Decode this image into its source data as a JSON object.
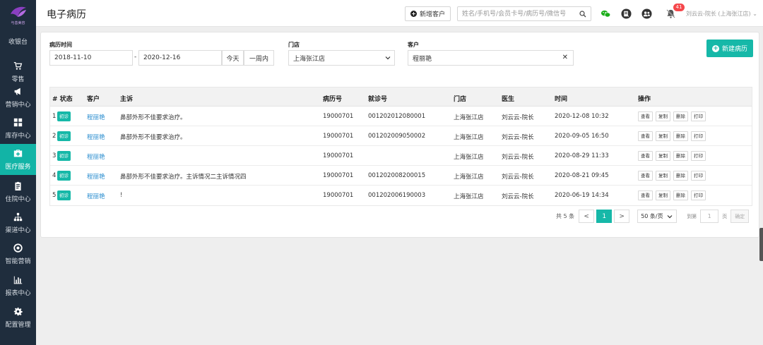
{
  "app": {
    "logo_text": "与善美容"
  },
  "sidebar": {
    "items": [
      {
        "label": "收银台",
        "icon": "cashier-icon"
      },
      {
        "label": "零售",
        "icon": "cart-icon"
      },
      {
        "label": "营销中心",
        "icon": "megaphone-icon"
      },
      {
        "label": "库存中心",
        "icon": "grid-icon"
      },
      {
        "label": "医疗服务",
        "icon": "medkit-icon",
        "active": true
      },
      {
        "label": "住院中心",
        "icon": "clipboard-icon"
      },
      {
        "label": "渠道中心",
        "icon": "sitemap-icon"
      },
      {
        "label": "智能营销",
        "icon": "life-ring-icon"
      },
      {
        "label": "报表中心",
        "icon": "bar-chart-icon"
      },
      {
        "label": "配置管理",
        "icon": "gear-icon"
      }
    ]
  },
  "header": {
    "title": "电子病历",
    "add_customer_label": "新增客户",
    "search_placeholder": "姓名/手机号/会员卡号/病历号/微信号",
    "notification_count": "41",
    "user": "刘云云-院长 (上海张江店)"
  },
  "filters": {
    "date_label": "病历时间",
    "date_from": "2018-11-10",
    "date_sep": "-",
    "date_to": "2020-12-16",
    "today_label": "今天",
    "week_label": "一周内",
    "store_label": "门店",
    "store_value": "上海张江店",
    "customer_label": "客户",
    "customer_value": "程丽艳",
    "clear_symbol": "✕",
    "new_record_label": "新建病历"
  },
  "table": {
    "headers": {
      "index_status": "# 状态",
      "customer": "客户",
      "complaint": "主诉",
      "record_no": "病历号",
      "visit_no": "就诊号",
      "store": "门店",
      "doctor": "医生",
      "time": "时间",
      "actions": "操作"
    },
    "action_labels": {
      "view": "查看",
      "copy": "复制",
      "delete": "删除",
      "print": "打印"
    },
    "rows": [
      {
        "index": "1",
        "status": "初诊",
        "customer": "程丽艳",
        "complaint": "鼻部外形不佳要求治疗。",
        "record_no": "19000701",
        "visit_no": "001202012080001",
        "store": "上海张江店",
        "doctor": "刘云云-院长",
        "time": "2020-12-08 10:32"
      },
      {
        "index": "2",
        "status": "初诊",
        "customer": "程丽艳",
        "complaint": "鼻部外形不佳要求治疗。",
        "record_no": "19000701",
        "visit_no": "001202009050002",
        "store": "上海张江店",
        "doctor": "刘云云-院长",
        "time": "2020-09-05 16:50"
      },
      {
        "index": "3",
        "status": "初诊",
        "customer": "程丽艳",
        "complaint": "",
        "record_no": "19000701",
        "visit_no": "",
        "store": "上海张江店",
        "doctor": "刘云云-院长",
        "time": "2020-08-29 11:33"
      },
      {
        "index": "4",
        "status": "初诊",
        "customer": "程丽艳",
        "complaint": "鼻部外形不佳要求治疗。主诉情况二主诉情况四",
        "record_no": "19000701",
        "visit_no": "001202008200015",
        "store": "上海张江店",
        "doctor": "刘云云-院长",
        "time": "2020-08-21 09:45"
      },
      {
        "index": "5",
        "status": "初诊",
        "customer": "程丽艳",
        "complaint": "!",
        "record_no": "19000701",
        "visit_no": "001202006190003",
        "store": "上海张江店",
        "doctor": "刘云云-院长",
        "time": "2020-06-19 14:34"
      }
    ]
  },
  "pagination": {
    "total": "共 5 条",
    "prev": "<",
    "current": "1",
    "next": ">",
    "page_size": "50 条/页",
    "goto_label": "到第",
    "goto_value": "1",
    "page_unit": "页",
    "confirm": "确定"
  },
  "colors": {
    "accent": "#16b8a8",
    "sidebar": "#1f2d3d",
    "link": "#2d8fd0",
    "badge": "#f5474b"
  }
}
